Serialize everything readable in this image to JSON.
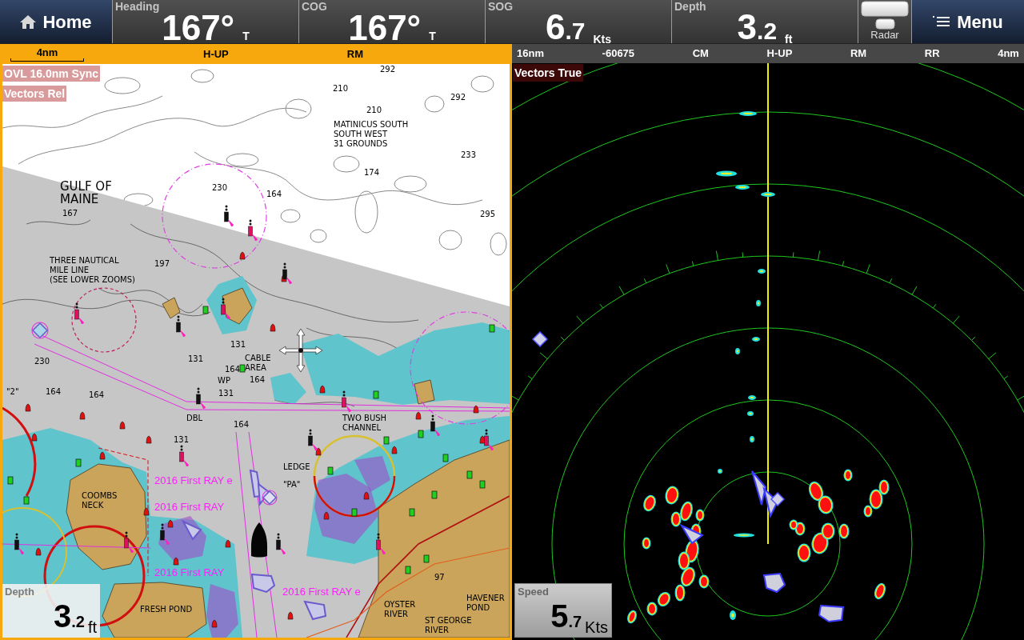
{
  "top_bar": {
    "home": {
      "label": "Home"
    },
    "readouts": [
      {
        "label": "Heading",
        "value": "167°",
        "unit": "T"
      },
      {
        "label": "COG",
        "value": "167°",
        "unit": "T"
      },
      {
        "label": "SOG",
        "value": "6",
        "decimal": ".7",
        "unit": "Kts"
      },
      {
        "label": "Depth",
        "value": "3",
        "decimal": ".2",
        "unit": "ft"
      }
    ],
    "radar_toggle": {
      "label": "Radar"
    },
    "menu": {
      "label": "Menu"
    }
  },
  "chart_pane": {
    "header": {
      "scale": "4nm",
      "orientation": "H-UP",
      "motion": "RM"
    },
    "overlays": [
      "OVL 16.0nm Sync",
      "Vectors Rel"
    ],
    "labels": [
      {
        "kind": "sounding",
        "text": "292"
      },
      {
        "kind": "sounding",
        "text": "210"
      },
      {
        "kind": "sounding",
        "text": "292"
      },
      {
        "kind": "sounding",
        "text": "210"
      },
      {
        "kind": "name",
        "text": "MATINICUS SOUTH\nSOUTH WEST\n31 GROUNDS"
      },
      {
        "kind": "sounding",
        "text": "233"
      },
      {
        "kind": "sounding",
        "text": "174"
      },
      {
        "kind": "region",
        "text": "GULF OF\nMAINE"
      },
      {
        "kind": "sounding",
        "text": "230"
      },
      {
        "kind": "sounding",
        "text": "164"
      },
      {
        "kind": "sounding",
        "text": "167"
      },
      {
        "kind": "sounding",
        "text": "295"
      },
      {
        "kind": "name",
        "text": "THREE NAUTICAL\nMILE LINE\n(SEE LOWER ZOOMS)"
      },
      {
        "kind": "sounding",
        "text": "197"
      },
      {
        "kind": "sounding",
        "text": "131"
      },
      {
        "kind": "sounding",
        "text": "230"
      },
      {
        "kind": "sounding",
        "text": "131"
      },
      {
        "kind": "sounding",
        "text": "164"
      },
      {
        "kind": "name",
        "text": "CABLE\nAREA"
      },
      {
        "kind": "name",
        "text": "WP"
      },
      {
        "kind": "sounding",
        "text": "164"
      },
      {
        "kind": "name",
        "text": "\"2\""
      },
      {
        "kind": "sounding",
        "text": "164"
      },
      {
        "kind": "sounding",
        "text": "164"
      },
      {
        "kind": "sounding",
        "text": "131"
      },
      {
        "kind": "name",
        "text": "DBL"
      },
      {
        "kind": "sounding",
        "text": "164"
      },
      {
        "kind": "name",
        "text": "TWO BUSH\nCHANNEL"
      },
      {
        "kind": "sounding",
        "text": "131"
      },
      {
        "kind": "name",
        "text": "LEDGE"
      },
      {
        "kind": "target",
        "text": "2016 First RAY e"
      },
      {
        "kind": "name",
        "text": "\"PA\""
      },
      {
        "kind": "name",
        "text": "COOMBS\nNECK"
      },
      {
        "kind": "target",
        "text": "2016 First RAY"
      },
      {
        "kind": "target",
        "text": "2016 First RAY"
      },
      {
        "kind": "sounding",
        "text": "97"
      },
      {
        "kind": "target",
        "text": "2016 First RAY e"
      },
      {
        "kind": "name",
        "text": "FRESH POND"
      },
      {
        "kind": "name",
        "text": "OYSTER\nRIVER"
      },
      {
        "kind": "name",
        "text": "HAVENER\nPOND"
      },
      {
        "kind": "name",
        "text": "ST GEORGE\nRIVER"
      }
    ],
    "depth_box": {
      "label": "Depth",
      "value": "3",
      "decimal": ".2",
      "unit": "ft"
    }
  },
  "radar_pane": {
    "header": [
      "16nm",
      "-60675",
      "CM",
      "H-UP",
      "RM",
      "RR",
      "4nm"
    ],
    "overlay": "Vectors True",
    "speed_box": {
      "label": "Speed",
      "value": "5",
      "decimal": ".7",
      "unit": "Kts"
    }
  }
}
